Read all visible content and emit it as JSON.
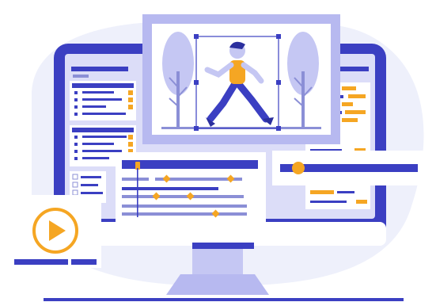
{
  "scene": {
    "description": "",
    "colors": {
      "indigo": "#3b3fc2",
      "indigo_dark": "#2b2f9e",
      "lavender": "#b7b9f0",
      "lavender_light": "#dcddf8",
      "pale": "#eef0fb",
      "orange": "#f5a623",
      "orange_dark": "#e8962b",
      "white": "#ffffff",
      "gray_line": "#8b8fd6"
    },
    "icons": [
      "play-icon",
      "walking-person-illustration",
      "tree-icon",
      "keyframe-diamond-icon",
      "playhead-icon",
      "scrubber-knob-icon"
    ]
  }
}
